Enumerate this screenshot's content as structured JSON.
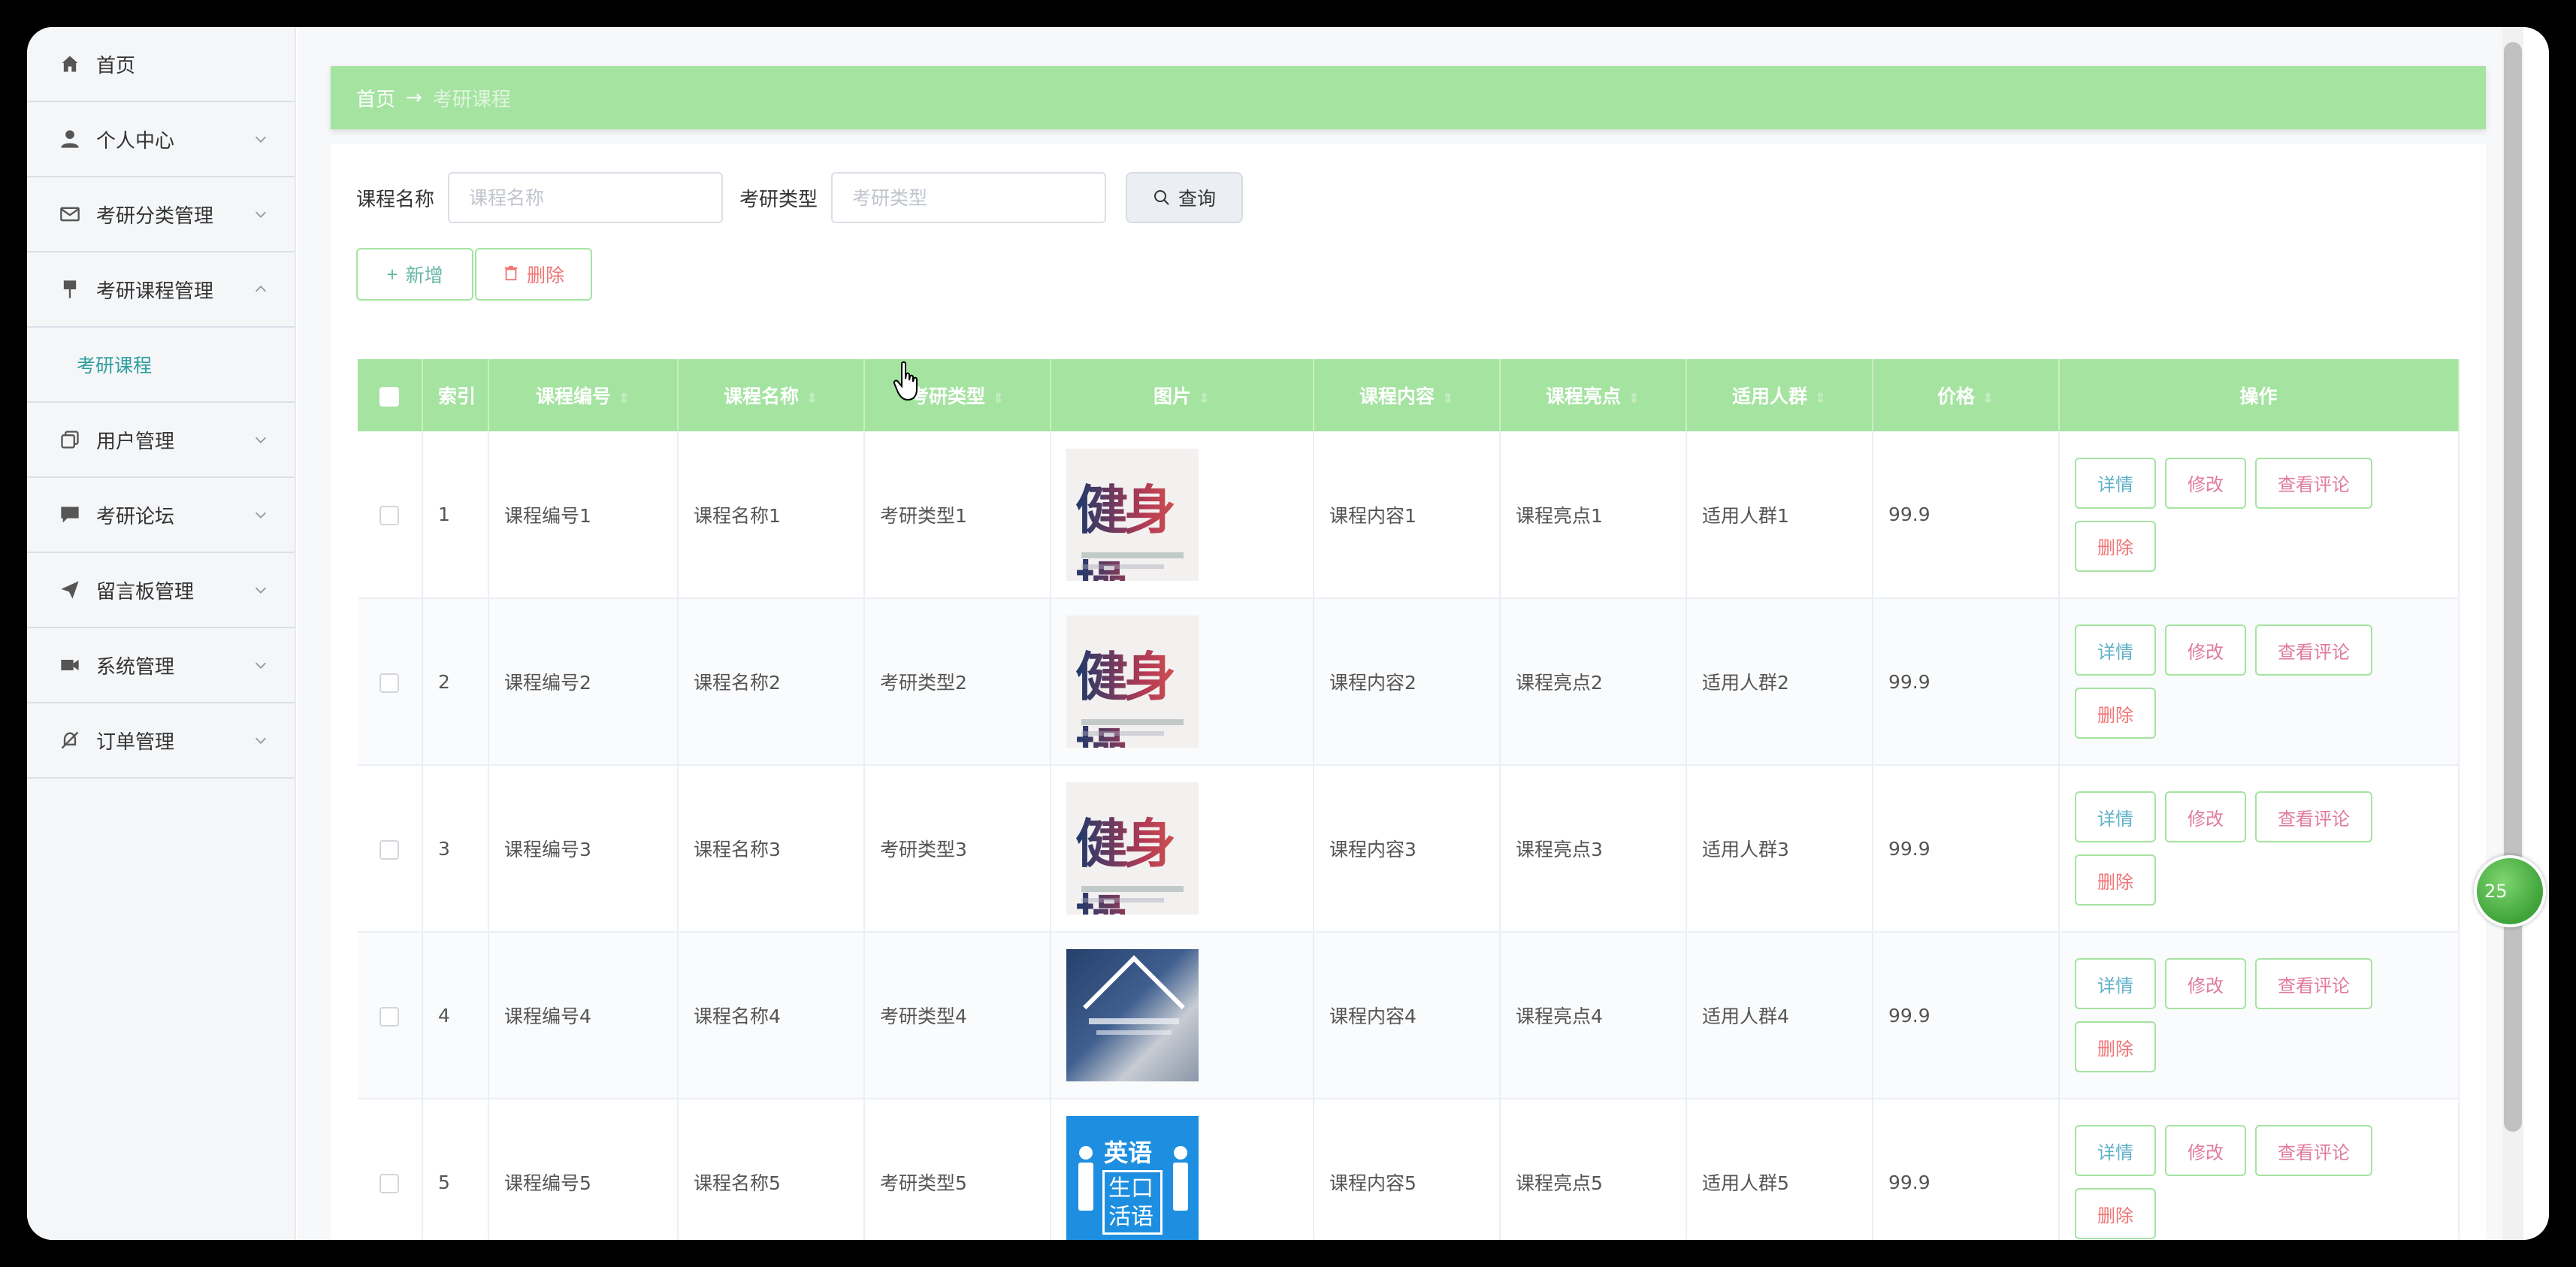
{
  "sidebar": {
    "items": [
      {
        "label": "首页",
        "icon": "home-icon"
      },
      {
        "label": "个人中心",
        "icon": "user-icon"
      },
      {
        "label": "考研分类管理",
        "icon": "mail-icon"
      },
      {
        "label": "考研课程管理",
        "icon": "pin-icon"
      },
      {
        "label": "用户管理",
        "icon": "copy-icon"
      },
      {
        "label": "考研论坛",
        "icon": "chat-icon"
      },
      {
        "label": "留言板管理",
        "icon": "send-icon"
      },
      {
        "label": "系统管理",
        "icon": "video-icon"
      },
      {
        "label": "订单管理",
        "icon": "bell-off-icon"
      }
    ],
    "submenu": {
      "label": "考研课程"
    }
  },
  "breadcrumb": {
    "home": "首页",
    "separator": "→",
    "current": "考研课程"
  },
  "search": {
    "name_label": "课程名称",
    "name_placeholder": "课程名称",
    "type_label": "考研类型",
    "type_placeholder": "考研类型",
    "query_label": "查询"
  },
  "actions": {
    "add_label": "新增",
    "delete_label": "删除"
  },
  "table": {
    "headers": [
      "索引",
      "课程编号",
      "课程名称",
      "考研类型",
      "图片",
      "课程内容",
      "课程亮点",
      "适用人群",
      "价格",
      "操作"
    ],
    "rows": [
      {
        "index": "1",
        "code": "课程编号1",
        "name": "课程名称1",
        "type": "考研类型1",
        "image": "calligraphy",
        "content": "课程内容1",
        "highlight": "课程亮点1",
        "audience": "适用人群1",
        "price": "99.9"
      },
      {
        "index": "2",
        "code": "课程编号2",
        "name": "课程名称2",
        "type": "考研类型2",
        "image": "calligraphy",
        "content": "课程内容2",
        "highlight": "课程亮点2",
        "audience": "适用人群2",
        "price": "99.9"
      },
      {
        "index": "3",
        "code": "课程编号3",
        "name": "课程名称3",
        "type": "考研类型3",
        "image": "calligraphy",
        "content": "课程内容3",
        "highlight": "课程亮点3",
        "audience": "适用人群3",
        "price": "99.9"
      },
      {
        "index": "4",
        "code": "课程编号4",
        "name": "课程名称4",
        "type": "考研类型4",
        "image": "photo",
        "content": "课程内容4",
        "highlight": "课程亮点4",
        "audience": "适用人群4",
        "price": "99.9"
      },
      {
        "index": "5",
        "code": "课程编号5",
        "name": "课程名称5",
        "type": "考研类型5",
        "image": "english",
        "content": "课程内容5",
        "highlight": "课程亮点5",
        "audience": "适用人群5",
        "price": "99.9"
      }
    ],
    "row_actions": {
      "detail": "详情",
      "edit": "修改",
      "comments": "查看评论",
      "delete": "删除"
    }
  },
  "thumb_text": {
    "calligraphy": "健身操",
    "english_top": "英语",
    "english_box": "生口活语"
  },
  "float_badge": {
    "text": "25"
  },
  "colors": {
    "accent": "#a5e3a1",
    "teal": "#2f9e9e",
    "danger": "#f07575"
  }
}
